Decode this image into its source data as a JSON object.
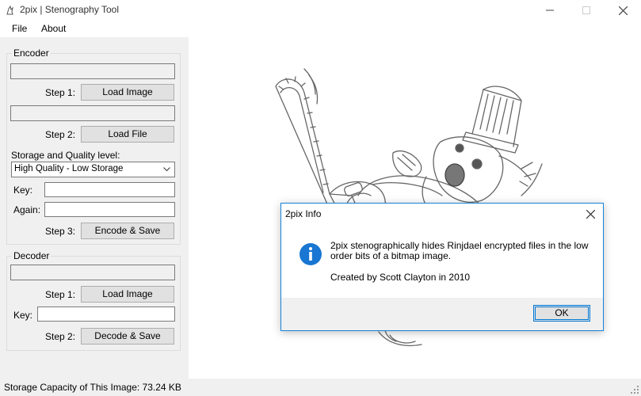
{
  "window": {
    "title": "2pix | Stenography Tool"
  },
  "menu": {
    "file": "File",
    "about": "About"
  },
  "encoder": {
    "group_label": "Encoder",
    "image_path": "",
    "step1_label": "Step 1:",
    "load_image": "Load Image",
    "file_path": "",
    "step2_label": "Step 2:",
    "load_file": "Load File",
    "quality_label": "Storage and Quality level:",
    "quality_value": "High Quality - Low Storage",
    "key_label": "Key:",
    "key_value": "",
    "again_label": "Again:",
    "again_value": "",
    "step3_label": "Step 3:",
    "encode_save": "Encode & Save"
  },
  "decoder": {
    "group_label": "Decoder",
    "image_path": "",
    "step1_label": "Step 1:",
    "load_image": "Load Image",
    "key_label": "Key:",
    "key_value": "",
    "step2_label": "Step 2:",
    "decode_save": "Decode & Save"
  },
  "status": {
    "capacity": "Storage Capacity of This Image: 73.24 KB"
  },
  "dialog": {
    "title": "2pix Info",
    "message": "2pix stenographically hides Rinjdael encrypted files in the low order bits of a bitmap image.",
    "credit": "Created by Scott Clayton in 2010",
    "ok": "OK"
  },
  "colors": {
    "accent": "#0078d7",
    "info_icon": "#1976d2",
    "dialog_border": "#1883d7"
  },
  "icons": [
    "app-icon",
    "minimize-icon",
    "maximize-icon",
    "close-icon",
    "chevron-down-icon",
    "info-icon",
    "resize-grip-icon"
  ]
}
